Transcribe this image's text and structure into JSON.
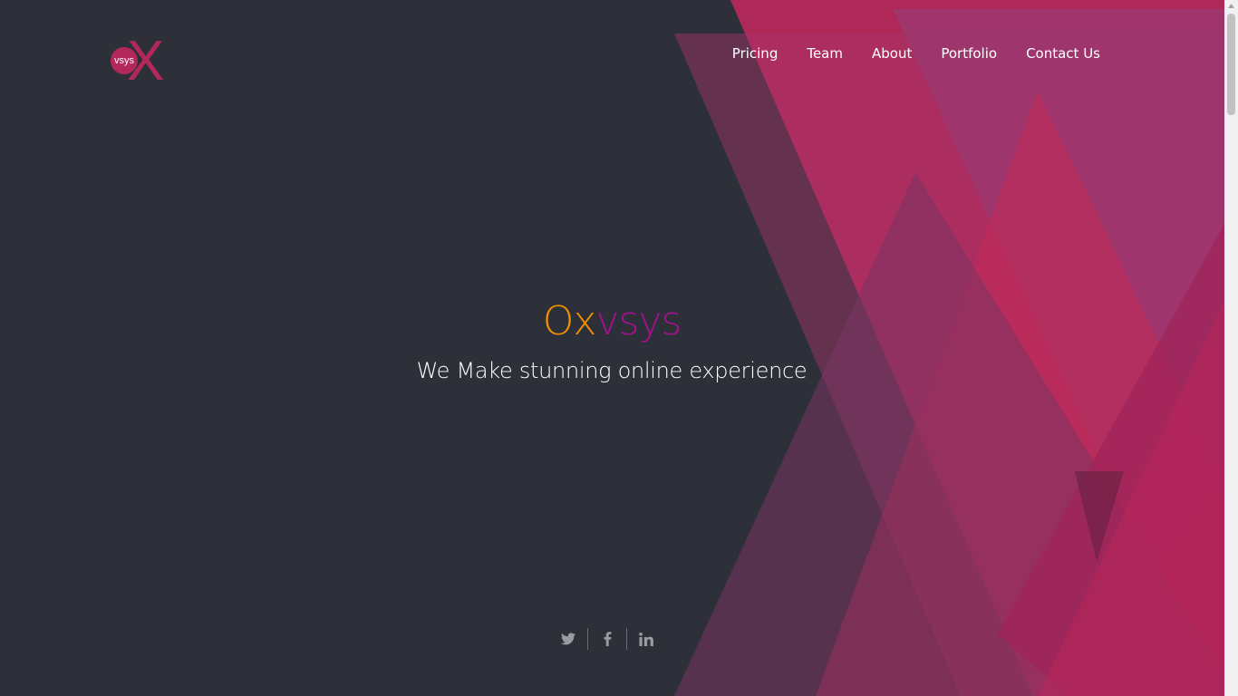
{
  "logo": {
    "circle_text": "vsys",
    "letter": "X"
  },
  "nav": {
    "items": [
      {
        "label": "Pricing"
      },
      {
        "label": "Team"
      },
      {
        "label": "About"
      },
      {
        "label": "Portfolio"
      },
      {
        "label": "Contact Us"
      }
    ]
  },
  "hero": {
    "title_part1": "Ox",
    "title_part2": "vsys",
    "subtitle": "We Make stunning online experience"
  },
  "social": {
    "icons": [
      "twitter-icon",
      "facebook-icon",
      "linkedin-icon"
    ]
  },
  "colors": {
    "background": "#2d3038",
    "brand": "#b3285b",
    "title_accent_1": "#f39200",
    "title_accent_2": "#a0128f"
  }
}
